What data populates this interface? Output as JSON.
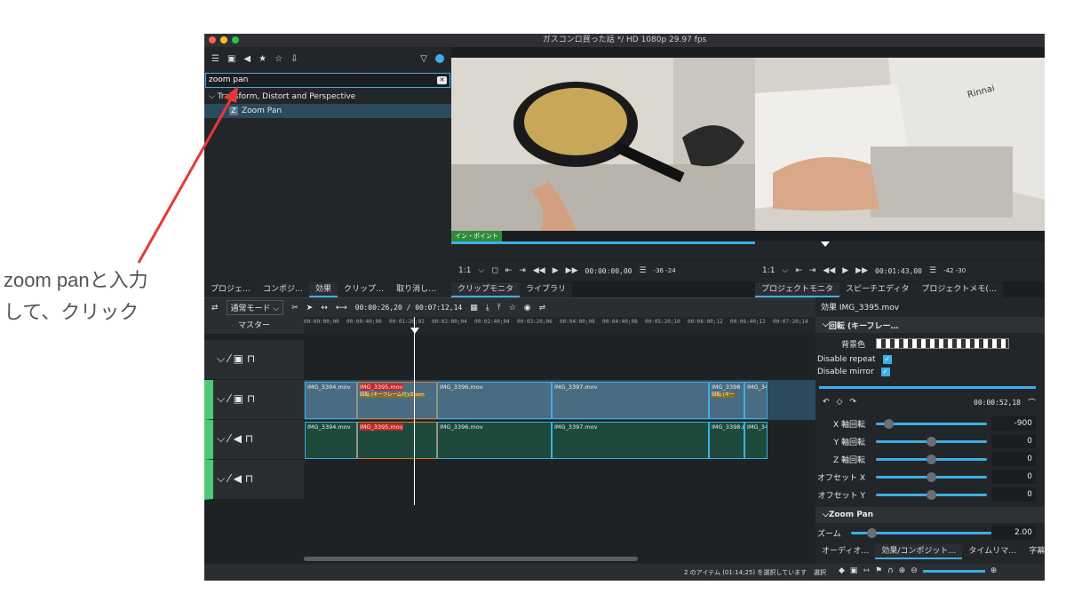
{
  "annotation": {
    "line1": "zoom panと入力",
    "line2": "して、クリック"
  },
  "window": {
    "title": "ガスコンロ買った話 */ HD 1080p 29.97 fps"
  },
  "effects": {
    "search_value": "zoom pan",
    "category": "Transform, Distort and Perspective",
    "item": "Zoom Pan",
    "item_icon": "Z",
    "tabs": [
      "プロジェ…",
      "コンポジ…",
      "効果",
      "クリップ…",
      "取り消し…"
    ],
    "active_tab": "効果"
  },
  "clip_monitor": {
    "badge": "イン・ポイント",
    "zoom": "1:1",
    "timecode": "00:00:00,00",
    "meter": "-36 -24",
    "tabs": [
      "クリップモニタ",
      "ライブラリ"
    ]
  },
  "project_monitor": {
    "brand": "Rinnai",
    "zoom": "1:1",
    "timecode": "00:01:43,00",
    "meter": "-42 -30",
    "tabs": [
      "プロジェクトモニタ",
      "スピーチエディタ",
      "プロジェクトメモ(…"
    ]
  },
  "timeline": {
    "mode": "通常モード",
    "timecode": "00:00:26,20 / 00:07:12,14",
    "master": "マスター",
    "ruler": [
      "00:00:00;00",
      "00:00:40;00",
      "00:01:20;02",
      "00:02:00;04",
      "00:02:40;04",
      "00:03:20;06",
      "00:04:00;08",
      "00:04:40;08",
      "00:05:20;10",
      "00:06:00;12",
      "00:06:40;12",
      "00:07:20;14"
    ],
    "video_clips": [
      "IMG_3394.mov",
      "IMG_3395.mov",
      "IMG_3396.mov",
      "IMG_3397.mov",
      "IMG_3398",
      "IMG_34"
    ],
    "video_sub": "回転 (キーフレーム付)/Zoom",
    "video_sub2": "回転 (キー",
    "audio_clips": [
      "IMG_3394.mov",
      "IMG_3395.mov",
      "IMG_3396.mov",
      "IMG_3397.mov",
      "IMG_3398.n",
      "IMG_34"
    ]
  },
  "properties": {
    "title": "効果 IMG_3395.mov",
    "effect1": "回転 (キーフレー…",
    "bg_label": "背景色",
    "disable_repeat": "Disable repeat",
    "disable_mirror": "Disable mirror",
    "kf_timecode": "00:00:52,18",
    "rows": [
      {
        "label": "X 軸回転",
        "value": "-900",
        "frac": 0.08
      },
      {
        "label": "Y 軸回転",
        "value": "0",
        "frac": 0.5
      },
      {
        "label": "Z 軸回転",
        "value": "0",
        "frac": 0.5
      },
      {
        "label": "オフセット X",
        "value": "0",
        "frac": 0.5
      },
      {
        "label": "オフセット Y",
        "value": "0",
        "frac": 0.5
      }
    ],
    "effect2": "Zoom Pan",
    "zoom_label": "ズーム",
    "zoom_value": "2.00",
    "zoom_frac": 0.12,
    "tabs": [
      "オーディオ…",
      "効果/コンポジット…",
      "タイムリマ…",
      "字幕"
    ]
  },
  "status": {
    "text": "2 のアイテム (01:14;25) を選択しています",
    "mode": "選択"
  },
  "colors": {
    "accent": "#3daee9",
    "arrow": "#e53935"
  }
}
